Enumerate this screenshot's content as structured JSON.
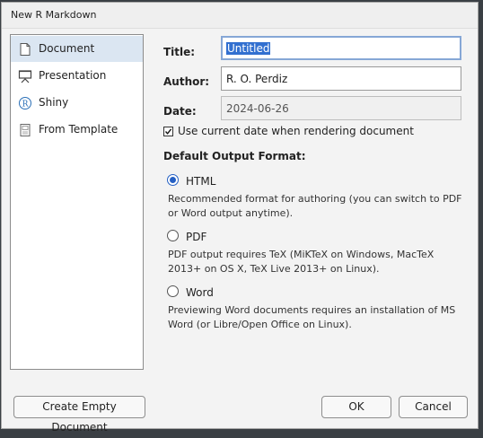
{
  "dialog": {
    "title": "New R Markdown"
  },
  "sidebar": {
    "items": [
      {
        "label": "Document",
        "icon": "document-icon",
        "selected": true
      },
      {
        "label": "Presentation",
        "icon": "presentation-icon",
        "selected": false
      },
      {
        "label": "Shiny",
        "icon": "shiny-icon",
        "selected": false
      },
      {
        "label": "From Template",
        "icon": "template-icon",
        "selected": false
      }
    ]
  },
  "form": {
    "title_label": "Title:",
    "title_value": "Untitled",
    "author_label": "Author:",
    "author_value": "R. O. Perdiz",
    "date_label": "Date:",
    "date_value": "2024-06-26",
    "use_current_date": {
      "label": "Use current date when rendering document",
      "checked": true
    },
    "output_format_heading": "Default Output Format:",
    "formats": [
      {
        "label": "HTML",
        "selected": true,
        "desc_lines": [
          "Recommended format for authoring (you can switch to PDF",
          "or Word output anytime)."
        ]
      },
      {
        "label": "PDF",
        "selected": false,
        "desc_lines": [
          "PDF output requires TeX (MiKTeX on Windows, MacTeX",
          "2013+ on OS X, TeX Live 2013+ on Linux)."
        ]
      },
      {
        "label": "Word",
        "selected": false,
        "desc_lines": [
          "Previewing Word documents requires an installation of MS",
          "Word (or Libre/Open Office on Linux)."
        ]
      }
    ]
  },
  "buttons": {
    "create_empty": "Create Empty Document",
    "ok": "OK",
    "cancel": "Cancel"
  },
  "colors": {
    "accent": "#2560c4",
    "selection_bg": "#3270d0",
    "sidebar_selected_bg": "#dbe6f2",
    "backdrop": "#3a3f44"
  }
}
